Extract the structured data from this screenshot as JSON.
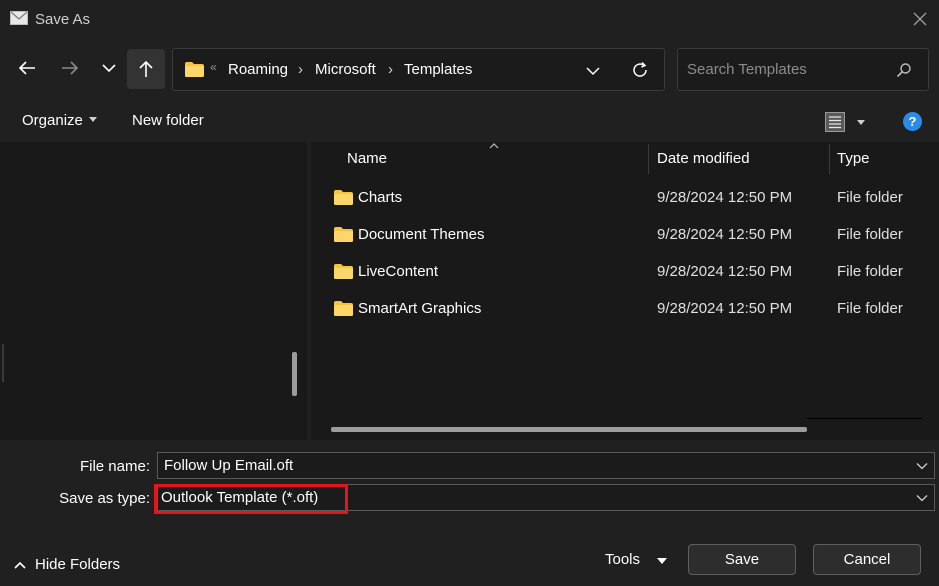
{
  "window": {
    "title": "Save As"
  },
  "address": {
    "overflow": "«",
    "crumbs": [
      "Roaming",
      "Microsoft",
      "Templates"
    ],
    "separator": "›"
  },
  "search": {
    "placeholder": "Search Templates"
  },
  "toolbar": {
    "organize": "Organize",
    "new_folder": "New folder",
    "help": "?"
  },
  "columns": {
    "name": "Name",
    "date": "Date modified",
    "type": "Type"
  },
  "files": [
    {
      "name": "Charts",
      "date": "9/28/2024 12:50 PM",
      "type": "File folder"
    },
    {
      "name": "Document Themes",
      "date": "9/28/2024 12:50 PM",
      "type": "File folder"
    },
    {
      "name": "LiveContent",
      "date": "9/28/2024 12:50 PM",
      "type": "File folder"
    },
    {
      "name": "SmartArt Graphics",
      "date": "9/28/2024 12:50 PM",
      "type": "File folder"
    }
  ],
  "form": {
    "file_name_label": "File name:",
    "file_name_value": "Follow Up Email.oft",
    "save_type_label": "Save as type:",
    "save_type_value": "Outlook Template (*.oft)"
  },
  "footer": {
    "hide_folders": "Hide Folders",
    "tools": "Tools",
    "save": "Save",
    "cancel": "Cancel"
  },
  "colors": {
    "background": "#202020",
    "pane": "#191919",
    "accent": "#2a8be8",
    "folder": "#f5c542",
    "highlight": "#e8141c"
  }
}
